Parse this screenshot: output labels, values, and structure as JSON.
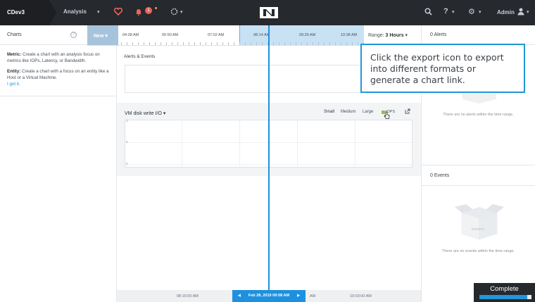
{
  "header": {
    "cluster_name": "CDev3",
    "nav_label": "Analysis",
    "alert_count": "1",
    "admin_label": "Admin"
  },
  "left_panel": {
    "title": "Charts",
    "metric_term": "Metric:",
    "metric_text": " Create a chart with an analysis focus on metrics like IOPs, Latency, or Bandwidth.",
    "entity_term": "Entity:",
    "entity_text": " Create a chart with a focus on an entity like a Host or a Virtual Machine.",
    "got_it": "I got it."
  },
  "timeline": {
    "new_label": "New",
    "ticks": [
      "04:38 AM",
      "05:50 AM",
      "07:02 AM",
      "08:14 AM",
      "09:26 AM",
      "10:38 AM"
    ],
    "range_label": "Range:",
    "range_value": "3 Hours"
  },
  "center": {
    "alerts_events_title": "Alerts & Events",
    "chart_title": "VM disk write I/O",
    "size_small": "Small",
    "size_medium": "Medium",
    "size_large": "Large",
    "legend_iops": "IOPS",
    "y_ticks": [
      "1",
      "0",
      "0"
    ]
  },
  "bottom_timeline": {
    "labels": [
      "08:15:00 AM",
      "10:03:00 AM"
    ],
    "current": "Feb 28, 2019 09:08 AM",
    "partial_label": "AM"
  },
  "right_panel": {
    "alerts_title": "0 Alerts",
    "alerts_empty": "There are no alerts within the time range.",
    "events_title": "0 Events",
    "events_empty": "There are no events within the time range.",
    "box_label": "EVENTS"
  },
  "tooltip": {
    "text": "Click the export icon to export into different formats or generate a chart link."
  },
  "status": {
    "complete_label": "Complete",
    "progress_fraction": 0.92
  },
  "colors": {
    "accent": "#2196d9",
    "topbar": "#26292e",
    "alert_red": "#e8645a"
  }
}
